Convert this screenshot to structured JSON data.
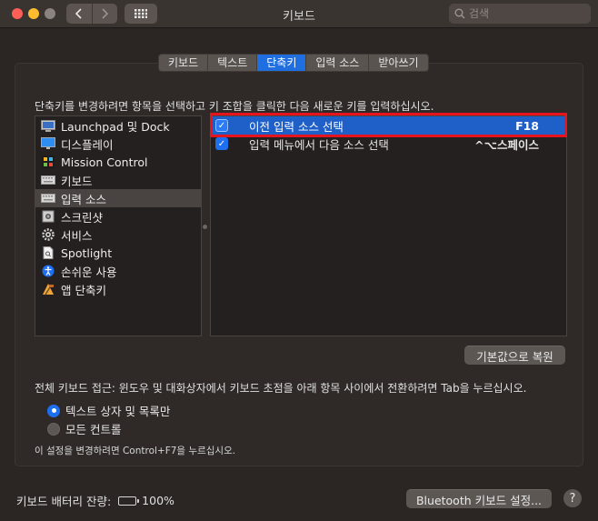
{
  "window": {
    "title": "키보드",
    "search_placeholder": "검색"
  },
  "tabs": [
    {
      "label": "키보드",
      "active": false
    },
    {
      "label": "텍스트",
      "active": false
    },
    {
      "label": "단축키",
      "active": true
    },
    {
      "label": "입력 소스",
      "active": false
    },
    {
      "label": "받아쓰기",
      "active": false
    }
  ],
  "instructions": "단축키를 변경하려면 항목을 선택하고 키 조합을 클릭한 다음 새로운 키를 입력하십시오.",
  "categories": [
    {
      "label": "Launchpad 및 Dock",
      "icon": "launchpad-icon"
    },
    {
      "label": "디스플레이",
      "icon": "display-icon"
    },
    {
      "label": "Mission Control",
      "icon": "mission-control-icon"
    },
    {
      "label": "키보드",
      "icon": "keyboard-icon"
    },
    {
      "label": "입력 소스",
      "icon": "keyboard-icon",
      "selected": true
    },
    {
      "label": "스크린샷",
      "icon": "screenshot-icon"
    },
    {
      "label": "서비스",
      "icon": "gear-icon"
    },
    {
      "label": "Spotlight",
      "icon": "spotlight-icon"
    },
    {
      "label": "손쉬운 사용",
      "icon": "accessibility-icon"
    },
    {
      "label": "앱 단축키",
      "icon": "app-shortcuts-icon"
    }
  ],
  "shortcuts": [
    {
      "label": "이전 입력 소스 선택",
      "key": "F18",
      "checked": true,
      "selected": true
    },
    {
      "label": "입력 메뉴에서 다음 소스 선택",
      "key": "^⌥스페이스",
      "checked": true,
      "selected": false
    }
  ],
  "restore_button": "기본값으로 복원",
  "full_keyboard_access": {
    "label": "전체 키보드 접근: 윈도우 및 대화상자에서 키보드 초점을 아래 항목 사이에서 전환하려면 Tab을 누르십시오.",
    "options": [
      "텍스트 상자 및 목록만",
      "모든 컨트롤"
    ],
    "selected_index": 0
  },
  "hint": "이 설정을 변경하려면 Control+F7을 누르십시오.",
  "battery": {
    "label": "키보드 배터리 잔량:",
    "value": "100%",
    "level": 1.0
  },
  "bluetooth_button": "Bluetooth 키보드 설정...",
  "help_button": "?",
  "colors": {
    "accent": "#1f6fe0",
    "highlight_box": "#e5141f",
    "background": "#2b2624"
  }
}
